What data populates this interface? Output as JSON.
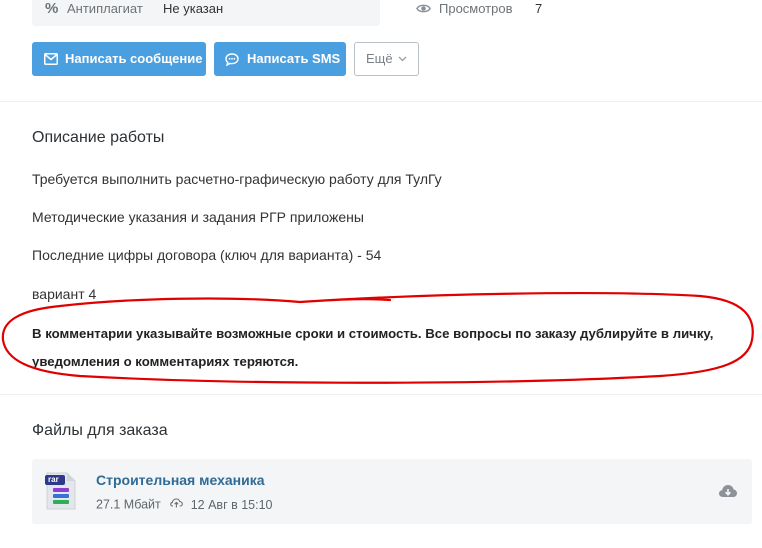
{
  "info": {
    "antiplagiat_label": "Антиплагиат",
    "antiplagiat_value": "Не указан",
    "views_label": "Просмотров",
    "views_count": "7"
  },
  "actions": {
    "message_label": "Написать сообщение",
    "sms_label": "Написать SMS",
    "more_label": "Ещё"
  },
  "description": {
    "heading": "Описание работы",
    "paragraphs": [
      "Требуется выполнить расчетно-графическую работу для ТулГу",
      "Методические указания и задания РГР приложены",
      "Последние цифры договора (ключ для варианта) - 54",
      "вариант 4"
    ],
    "note_line1": "В комментарии указывайте возможные сроки и стоимость. Все вопросы по заказу дублируйте в личку,",
    "note_line2": "уведомления о комментариях теряются."
  },
  "files": {
    "heading": "Файлы для заказа",
    "items": [
      {
        "name": "Строительная механика",
        "ext": "rar",
        "size": "27.1 Мбайт",
        "date": "12 Авг в 15:10"
      }
    ]
  },
  "colors": {
    "accent": "#4a9fe1",
    "annotation": "#e00000",
    "link": "#2e6b96"
  }
}
